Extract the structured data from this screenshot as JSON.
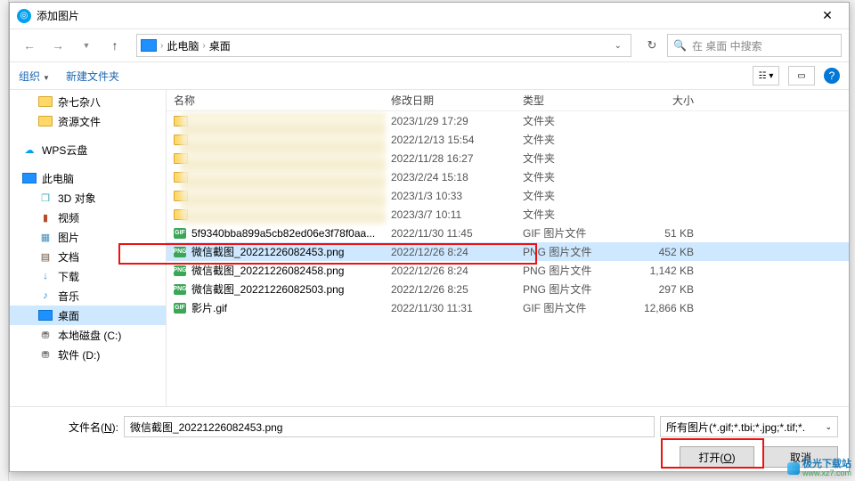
{
  "title": "添加图片",
  "breadcrumb": {
    "root_icon": "pc",
    "items": [
      "此电脑",
      "桌面"
    ]
  },
  "search": {
    "placeholder": "在 桌面 中搜索"
  },
  "toolbar": {
    "organize": "组织",
    "newfolder": "新建文件夹"
  },
  "columns": {
    "name": "名称",
    "date": "修改日期",
    "type": "类型",
    "size": "大小"
  },
  "sidebar": [
    {
      "icon": "folder",
      "label": "杂七杂八",
      "lvl": 1
    },
    {
      "icon": "folder",
      "label": "资源文件",
      "lvl": 1
    },
    {
      "icon": "wps",
      "label": "WPS云盘",
      "lvl": 0
    },
    {
      "icon": "pc",
      "label": "此电脑",
      "lvl": 0
    },
    {
      "icon": "cube",
      "label": "3D 对象",
      "lvl": 1
    },
    {
      "icon": "video",
      "label": "视频",
      "lvl": 1
    },
    {
      "icon": "pic",
      "label": "图片",
      "lvl": 1
    },
    {
      "icon": "doc",
      "label": "文档",
      "lvl": 1
    },
    {
      "icon": "dl",
      "label": "下载",
      "lvl": 1
    },
    {
      "icon": "music",
      "label": "音乐",
      "lvl": 1
    },
    {
      "icon": "desk",
      "label": "桌面",
      "lvl": 1,
      "selected": true
    },
    {
      "icon": "drive",
      "label": "本地磁盘 (C:)",
      "lvl": 1
    },
    {
      "icon": "drive",
      "label": "软件 (D:)",
      "lvl": 1
    }
  ],
  "files": [
    {
      "name": "",
      "date": "2023/1/29 17:29",
      "type": "文件夹",
      "size": "",
      "kind": "folder",
      "blur": true
    },
    {
      "name": "",
      "date": "2022/12/13 15:54",
      "type": "文件夹",
      "size": "",
      "kind": "folder",
      "blur": true
    },
    {
      "name": "",
      "date": "2022/11/28 16:27",
      "type": "文件夹",
      "size": "",
      "kind": "folder",
      "blur": true
    },
    {
      "name": "",
      "date": "2023/2/24 15:18",
      "type": "文件夹",
      "size": "",
      "kind": "folder",
      "blur": true
    },
    {
      "name": "",
      "date": "2023/1/3 10:33",
      "type": "文件夹",
      "size": "",
      "kind": "folder",
      "blur": true
    },
    {
      "name": "",
      "date": "2023/3/7 10:11",
      "type": "文件夹",
      "size": "",
      "kind": "folder",
      "blur": true
    },
    {
      "name": "5f9340bba899a5cb82ed06e3f78f0aa...",
      "date": "2022/11/30 11:45",
      "type": "GIF 图片文件",
      "size": "51 KB",
      "kind": "gif"
    },
    {
      "name": "微信截图_20221226082453.png",
      "date": "2022/12/26 8:24",
      "type": "PNG 图片文件",
      "size": "452 KB",
      "kind": "png",
      "selected": true
    },
    {
      "name": "微信截图_20221226082458.png",
      "date": "2022/12/26 8:24",
      "type": "PNG 图片文件",
      "size": "1,142 KB",
      "kind": "png"
    },
    {
      "name": "微信截图_20221226082503.png",
      "date": "2022/12/26 8:25",
      "type": "PNG 图片文件",
      "size": "297 KB",
      "kind": "png"
    },
    {
      "name": "影片.gif",
      "date": "2022/11/30 11:31",
      "type": "GIF 图片文件",
      "size": "12,866 KB",
      "kind": "gif"
    }
  ],
  "filename": {
    "label": "文件名(N):",
    "value": "微信截图_20221226082453.png"
  },
  "filter": "所有图片(*.gif;*.tbi;*.jpg;*.tif;*.",
  "buttons": {
    "open": "打开(O)",
    "cancel": "取消"
  },
  "watermark": {
    "text": "极光下载站",
    "url": "www.xz7.com"
  }
}
